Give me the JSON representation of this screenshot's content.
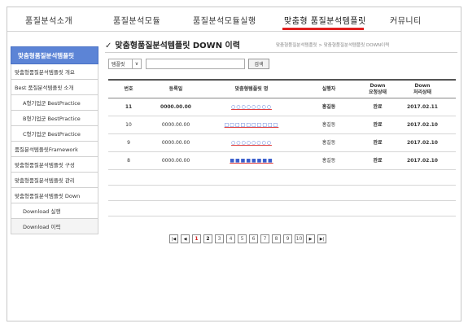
{
  "nav": {
    "items": [
      "품질분석소개",
      "품질분석모듈",
      "품질분석모듈실행",
      "맞춤형 품질분석템플릿",
      "커뮤니티"
    ],
    "active_index": 3
  },
  "sidebar": {
    "header": "맞춤형품질분석템플릿",
    "items": [
      {
        "label": "맞춤형품질분석템플릿 개요"
      },
      {
        "label": "Best 품질분석템플릿 소개"
      },
      {
        "label": "A형기업군 BestPractice"
      },
      {
        "label": "B형기업군 BestPractice"
      },
      {
        "label": "C형기업군 BestPractice"
      },
      {
        "label": "품질분석템플릿Framework"
      },
      {
        "label": "맞춤형품질분석템플릿 구성"
      },
      {
        "label": "맞춤형품질분석템플릿 관리"
      },
      {
        "label": "맞춤형품질분석템플릿 Down"
      },
      {
        "label": "Download 실행"
      },
      {
        "label": "Download 이력"
      }
    ]
  },
  "main": {
    "title": "맞춤형품질분석템플릿 DOWN 이력",
    "check_glyph": "✓",
    "breadcrumb": "맞춤형품질분석템플릿 > 맞춤형품질분석템플릿 DOWN이력"
  },
  "search": {
    "select_value": "템플릿",
    "input_value": "",
    "button_label": "검색"
  },
  "table": {
    "headers": {
      "no": "번호",
      "date": "등록일",
      "name": "맞춤형템플릿 명",
      "user": "실행자",
      "req_line1": "Down",
      "req_line2": "요청상태",
      "proc_line1": "Down",
      "proc_line2": "처리상태"
    },
    "rows": [
      {
        "no": "11",
        "date": "0000.00.00",
        "name": "○○○○○○○○",
        "user": "홍길동",
        "req": "완료",
        "proc": "2017.02.11"
      },
      {
        "no": "10",
        "date": "0000.00.00",
        "name": "□□□□□□□□□□",
        "user": "홍길동",
        "req": "완료",
        "proc": "2017.02.10"
      },
      {
        "no": "9",
        "date": "0000.00.00",
        "name": "○○○○○○○○",
        "user": "홍길동",
        "req": "완료",
        "proc": "2017.02.10"
      },
      {
        "no": "8",
        "date": "0000.00.00",
        "name": "■■■■■■■■",
        "user": "홍길동",
        "req": "완료",
        "proc": "2017.02.10"
      }
    ]
  },
  "pager": {
    "first": "|◀",
    "prev": "◀",
    "pages": [
      "1",
      "2",
      "3",
      "4",
      "5",
      "6",
      "7",
      "8",
      "9",
      "10"
    ],
    "current": "1",
    "next": "▶",
    "last": "▶|"
  }
}
